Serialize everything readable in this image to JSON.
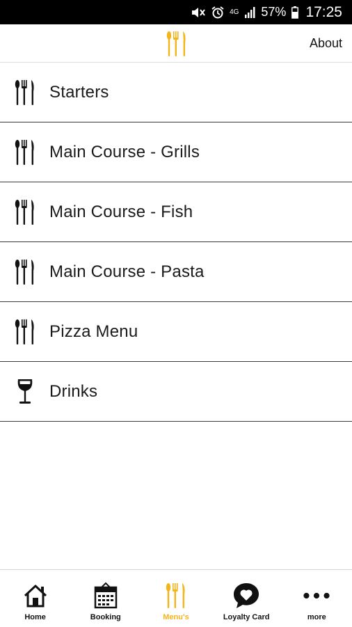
{
  "status_bar": {
    "battery_pct": "57%",
    "time": "17:25",
    "network": "4G",
    "icons": [
      "mute-icon",
      "alarm-icon",
      "network-4g-icon",
      "signal-icon",
      "battery-icon"
    ]
  },
  "header": {
    "logo_icon": "cutlery-icon",
    "about_label": "About"
  },
  "menu": {
    "items": [
      {
        "label": "Starters",
        "icon": "cutlery-icon"
      },
      {
        "label": "Main Course - Grills",
        "icon": "cutlery-icon"
      },
      {
        "label": "Main Course - Fish",
        "icon": "cutlery-icon"
      },
      {
        "label": "Main Course - Pasta",
        "icon": "cutlery-icon"
      },
      {
        "label": "Pizza Menu",
        "icon": "cutlery-icon"
      },
      {
        "label": "Drinks",
        "icon": "wine-glass-icon"
      }
    ]
  },
  "tabs": [
    {
      "label": "Home",
      "icon": "home-icon",
      "active": false
    },
    {
      "label": "Booking",
      "icon": "calendar-icon",
      "active": false
    },
    {
      "label": "Menu's",
      "icon": "cutlery-icon",
      "active": true
    },
    {
      "label": "Loyalty Card",
      "icon": "heart-bubble-icon",
      "active": false
    },
    {
      "label": "more",
      "icon": "more-dots-icon",
      "active": false
    }
  ],
  "colors": {
    "accent": "#f4b41a",
    "text": "#1a1a1a",
    "divider": "#3a3a3a"
  }
}
